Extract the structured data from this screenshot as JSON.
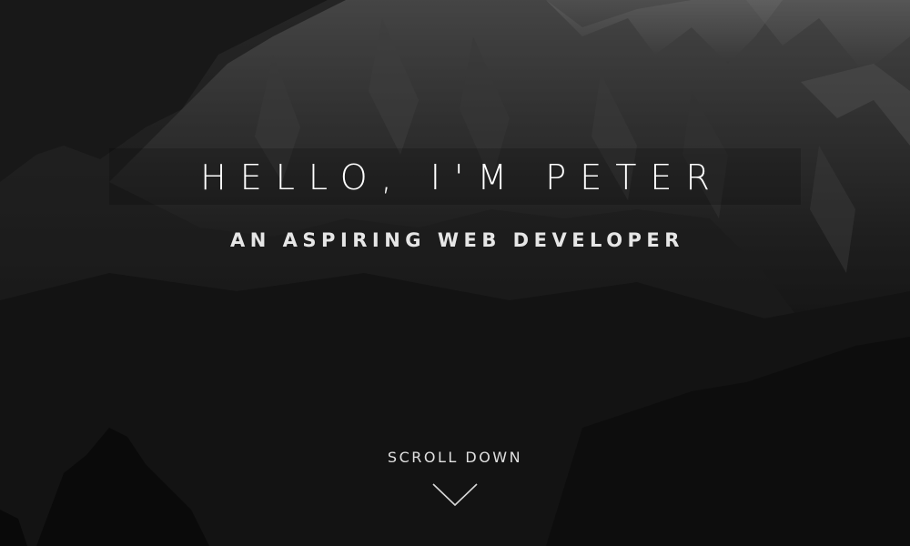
{
  "hero": {
    "title": "HELLO, I'M PETER",
    "subtitle": "AN ASPIRING WEB DEVELOPER",
    "scroll_label": "SCROLL DOWN",
    "scroll_icon": "chevron-down-icon",
    "background_image": "mountain-landscape-grayscale"
  },
  "colors": {
    "text_primary": "#ffffff",
    "text_secondary": "#e6e6e6",
    "background": "#1c1c1c"
  }
}
